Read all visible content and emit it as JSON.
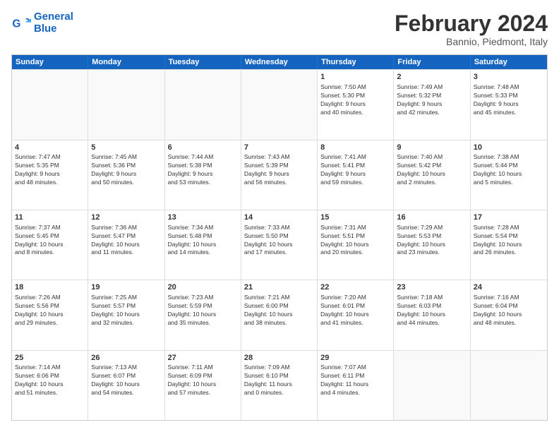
{
  "logo": {
    "line1": "General",
    "line2": "Blue"
  },
  "header": {
    "title": "February 2024",
    "subtitle": "Bannio, Piedmont, Italy"
  },
  "days": [
    "Sunday",
    "Monday",
    "Tuesday",
    "Wednesday",
    "Thursday",
    "Friday",
    "Saturday"
  ],
  "rows": [
    [
      {
        "day": "",
        "text": "",
        "empty": true
      },
      {
        "day": "",
        "text": "",
        "empty": true
      },
      {
        "day": "",
        "text": "",
        "empty": true
      },
      {
        "day": "",
        "text": "",
        "empty": true
      },
      {
        "day": "1",
        "text": "Sunrise: 7:50 AM\nSunset: 5:30 PM\nDaylight: 9 hours\nand 40 minutes."
      },
      {
        "day": "2",
        "text": "Sunrise: 7:49 AM\nSunset: 5:32 PM\nDaylight: 9 hours\nand 42 minutes."
      },
      {
        "day": "3",
        "text": "Sunrise: 7:48 AM\nSunset: 5:33 PM\nDaylight: 9 hours\nand 45 minutes."
      }
    ],
    [
      {
        "day": "4",
        "text": "Sunrise: 7:47 AM\nSunset: 5:35 PM\nDaylight: 9 hours\nand 48 minutes."
      },
      {
        "day": "5",
        "text": "Sunrise: 7:45 AM\nSunset: 5:36 PM\nDaylight: 9 hours\nand 50 minutes."
      },
      {
        "day": "6",
        "text": "Sunrise: 7:44 AM\nSunset: 5:38 PM\nDaylight: 9 hours\nand 53 minutes."
      },
      {
        "day": "7",
        "text": "Sunrise: 7:43 AM\nSunset: 5:39 PM\nDaylight: 9 hours\nand 56 minutes."
      },
      {
        "day": "8",
        "text": "Sunrise: 7:41 AM\nSunset: 5:41 PM\nDaylight: 9 hours\nand 59 minutes."
      },
      {
        "day": "9",
        "text": "Sunrise: 7:40 AM\nSunset: 5:42 PM\nDaylight: 10 hours\nand 2 minutes."
      },
      {
        "day": "10",
        "text": "Sunrise: 7:38 AM\nSunset: 5:44 PM\nDaylight: 10 hours\nand 5 minutes."
      }
    ],
    [
      {
        "day": "11",
        "text": "Sunrise: 7:37 AM\nSunset: 5:45 PM\nDaylight: 10 hours\nand 8 minutes."
      },
      {
        "day": "12",
        "text": "Sunrise: 7:36 AM\nSunset: 5:47 PM\nDaylight: 10 hours\nand 11 minutes."
      },
      {
        "day": "13",
        "text": "Sunrise: 7:34 AM\nSunset: 5:48 PM\nDaylight: 10 hours\nand 14 minutes."
      },
      {
        "day": "14",
        "text": "Sunrise: 7:33 AM\nSunset: 5:50 PM\nDaylight: 10 hours\nand 17 minutes."
      },
      {
        "day": "15",
        "text": "Sunrise: 7:31 AM\nSunset: 5:51 PM\nDaylight: 10 hours\nand 20 minutes."
      },
      {
        "day": "16",
        "text": "Sunrise: 7:29 AM\nSunset: 5:53 PM\nDaylight: 10 hours\nand 23 minutes."
      },
      {
        "day": "17",
        "text": "Sunrise: 7:28 AM\nSunset: 5:54 PM\nDaylight: 10 hours\nand 26 minutes."
      }
    ],
    [
      {
        "day": "18",
        "text": "Sunrise: 7:26 AM\nSunset: 5:56 PM\nDaylight: 10 hours\nand 29 minutes."
      },
      {
        "day": "19",
        "text": "Sunrise: 7:25 AM\nSunset: 5:57 PM\nDaylight: 10 hours\nand 32 minutes."
      },
      {
        "day": "20",
        "text": "Sunrise: 7:23 AM\nSunset: 5:59 PM\nDaylight: 10 hours\nand 35 minutes."
      },
      {
        "day": "21",
        "text": "Sunrise: 7:21 AM\nSunset: 6:00 PM\nDaylight: 10 hours\nand 38 minutes."
      },
      {
        "day": "22",
        "text": "Sunrise: 7:20 AM\nSunset: 6:01 PM\nDaylight: 10 hours\nand 41 minutes."
      },
      {
        "day": "23",
        "text": "Sunrise: 7:18 AM\nSunset: 6:03 PM\nDaylight: 10 hours\nand 44 minutes."
      },
      {
        "day": "24",
        "text": "Sunrise: 7:16 AM\nSunset: 6:04 PM\nDaylight: 10 hours\nand 48 minutes."
      }
    ],
    [
      {
        "day": "25",
        "text": "Sunrise: 7:14 AM\nSunset: 6:06 PM\nDaylight: 10 hours\nand 51 minutes."
      },
      {
        "day": "26",
        "text": "Sunrise: 7:13 AM\nSunset: 6:07 PM\nDaylight: 10 hours\nand 54 minutes."
      },
      {
        "day": "27",
        "text": "Sunrise: 7:11 AM\nSunset: 6:09 PM\nDaylight: 10 hours\nand 57 minutes."
      },
      {
        "day": "28",
        "text": "Sunrise: 7:09 AM\nSunset: 6:10 PM\nDaylight: 11 hours\nand 0 minutes."
      },
      {
        "day": "29",
        "text": "Sunrise: 7:07 AM\nSunset: 6:11 PM\nDaylight: 11 hours\nand 4 minutes."
      },
      {
        "day": "",
        "text": "",
        "empty": true
      },
      {
        "day": "",
        "text": "",
        "empty": true
      }
    ]
  ]
}
